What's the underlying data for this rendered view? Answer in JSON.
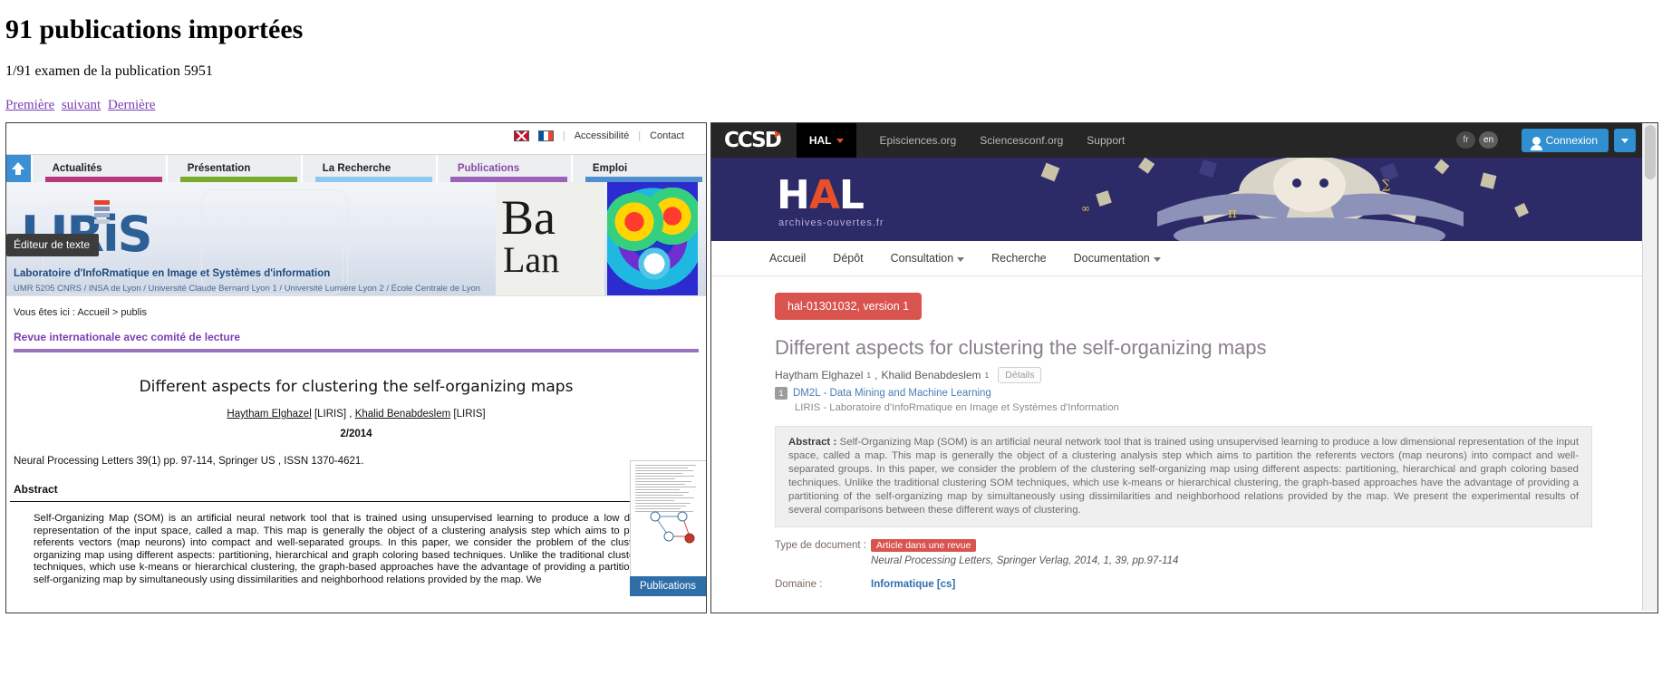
{
  "report": {
    "title": "91 publications importées",
    "counter": "1/91 examen de la publication 5951",
    "pager": {
      "first": "Première",
      "next": "suivant",
      "last": "Dernière"
    }
  },
  "tooltip": {
    "label": "Éditeur de texte"
  },
  "liris": {
    "toplinks": {
      "accessibility": "Accessibilité",
      "contact": "Contact"
    },
    "flags": [
      "flag-en-icon",
      "flag-fr-icon"
    ],
    "nav": [
      {
        "label": "Actualités",
        "color": "#b8377f"
      },
      {
        "label": "Présentation",
        "color": "#7aab2e"
      },
      {
        "label": "La Recherche",
        "color": "#8cc9f0"
      },
      {
        "label": "Publications",
        "color": "#9a63b8"
      },
      {
        "label": "Emploi",
        "color": "#4f8fd0"
      }
    ],
    "logo_text": "LIRiS",
    "lab_name": "Laboratoire d'InfoRmatique en Image et Systèmes d'information",
    "umr": "UMR 5205 CNRS / INSA de Lyon / Université Claude Bernard Lyon 1 / Université Lumière Lyon 2 / École Centrale de Lyon",
    "breadcrumb": "Vous êtes ici : Accueil > publis",
    "section": "Revue internationale avec comité de lecture",
    "publication": {
      "title": "Different aspects for clustering the self-organizing maps",
      "author1": "Haytham Elghazel",
      "author1_aff": "[LIRIS]",
      "separator": " , ",
      "author2": "Khalid Benabdeslem",
      "author2_aff": "[LIRIS]",
      "date": "2/2014",
      "reference": "Neural Processing Letters 39(1) pp. 97-114, Springer US , ISSN 1370-4621.",
      "abstract_heading": "Abstract",
      "abstract": "Self-Organizing Map (SOM) is an artificial neural network tool that is trained using unsupervised learning to produce a low dimensional representation of the input space, called a map. This map is generally the object of a clustering analysis step which aims to partition the referents vectors (map neurons) into compact and well-separated groups. In this paper, we consider the problem of the clustering self-organizing map using different aspects: partitioning, hierarchical and graph coloring based techniques. Unlike the traditional clustering SOM techniques, which use k-means or hierarchical clustering, the graph-based approaches have the advantage of providing a partitioning of the self-organizing map by simultaneously using dissimilarities and neighborhood relations provided by the map. We"
    },
    "thumb_badge": "Publications"
  },
  "hal": {
    "topbar": {
      "ccsd": "CCSD",
      "hal": "HAL",
      "links": [
        "Episciences.org",
        "Sciencesconf.org",
        "Support"
      ],
      "lang_fr": "fr",
      "lang_en": "en",
      "login": "Connexion"
    },
    "hero": {
      "logo": "HAL",
      "tagline": "archives-ouvertes.fr"
    },
    "nav": [
      "Accueil",
      "Dépôt",
      "Consultation",
      "Recherche",
      "Documentation"
    ],
    "record": {
      "id_badge": "hal-01301032, version 1",
      "title": "Different aspects for clustering the self-organizing maps",
      "author1": "Haytham Elghazel",
      "author1_sup": "1",
      "author_sep": ", ",
      "author2": "Khalid Benabdeslem",
      "author2_sup": "1",
      "details_btn": "Détails",
      "aff_num": "1",
      "aff_name": "DM2L - Data Mining and Machine Learning",
      "aff_sub": "LIRIS - Laboratoire d'InfoRmatique en Image et Systèmes d'Information",
      "abstract_label": "Abstract",
      "abstract_colon": " : ",
      "abstract": "Self-Organizing Map (SOM) is an artificial neural network tool that is trained using unsupervised learning to produce a low dimensional representation of the input space, called a map. This map is generally the object of a clustering analysis step which aims to partition the referents vectors (map neurons) into compact and well-separated groups. In this paper, we consider the problem of the clustering self-organizing map using different aspects: partitioning, hierarchical and graph coloring based techniques. Unlike the traditional clustering SOM techniques, which use k-means or hierarchical clustering, the graph-based approaches have the advantage of providing a partitioning of the self-organizing map by simultaneously using dissimilarities and neighborhood relations provided by the map. We present the experimental results of several comparisons between these different ways of clustering.",
      "doctype_label": "Type de document :",
      "doctype_pill": "Article dans une revue",
      "doctype_ref": "Neural Processing Letters, Springer Verlag, 2014, 1, 39, pp.97-114",
      "domain_label": "Domaine :",
      "domain_value": "Informatique [cs]"
    }
  },
  "colors": {
    "accent_purple": "#7a3fb5",
    "hal_blue": "#2d2a68",
    "hal_red": "#d9534f",
    "liris_blue": "#2b5f96",
    "login_blue": "#2f8fd0"
  }
}
